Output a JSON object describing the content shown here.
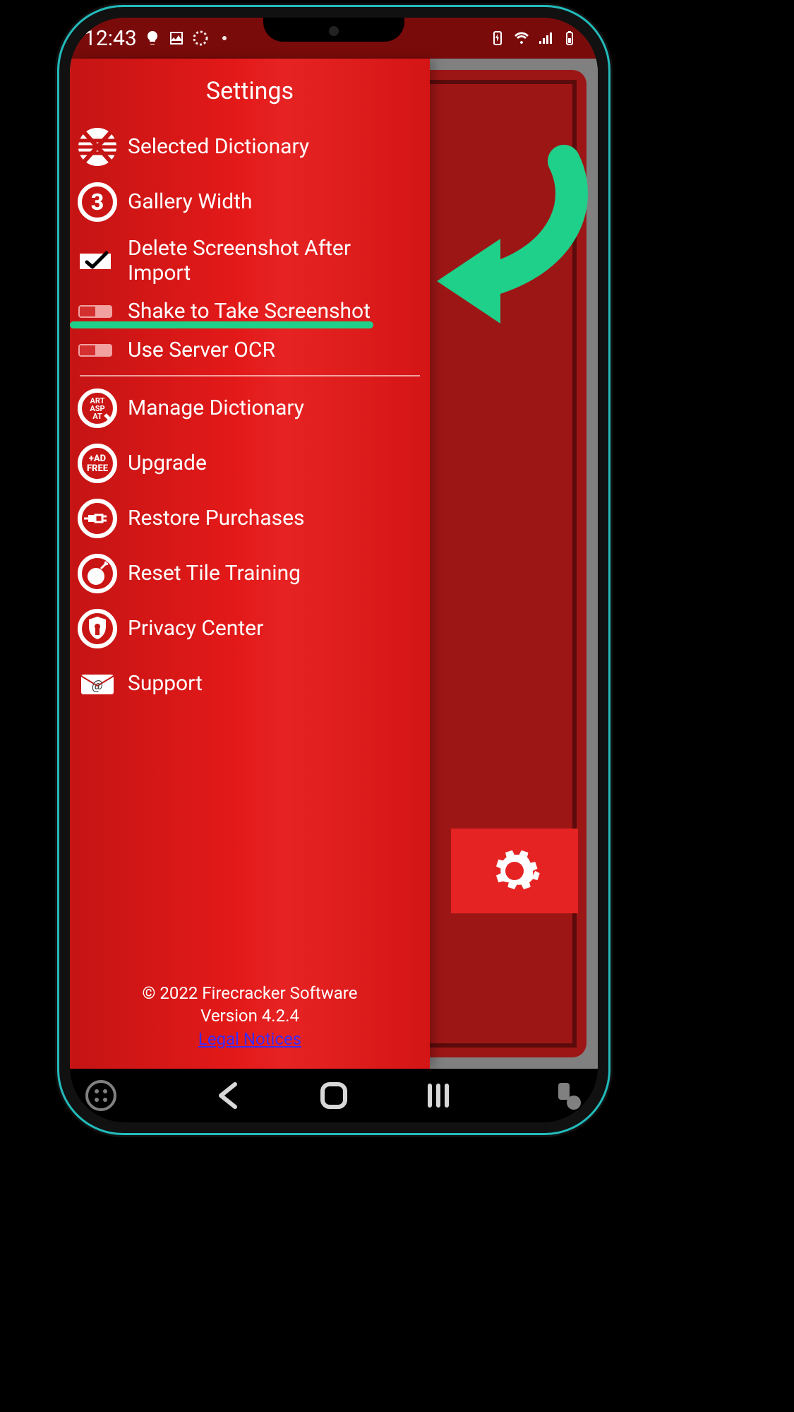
{
  "status": {
    "time": "12:43"
  },
  "panel": {
    "title": "Settings",
    "items": {
      "dictionary": "Selected Dictionary",
      "gallery": "Gallery Width",
      "gallery_value": "3",
      "delete_after": "Delete Screenshot After Import",
      "shake": "Shake to Take Screenshot",
      "ocr": "Use Server OCR",
      "manage": "Manage Dictionary",
      "upgrade": "Upgrade",
      "restore": "Restore Purchases",
      "reset": "Reset Tile Training",
      "privacy": "Privacy Center",
      "support": "Support"
    },
    "footer": {
      "copyright": "© 2022 Firecracker Software",
      "version": "Version 4.2.4",
      "legal": "Legal Notices"
    }
  }
}
